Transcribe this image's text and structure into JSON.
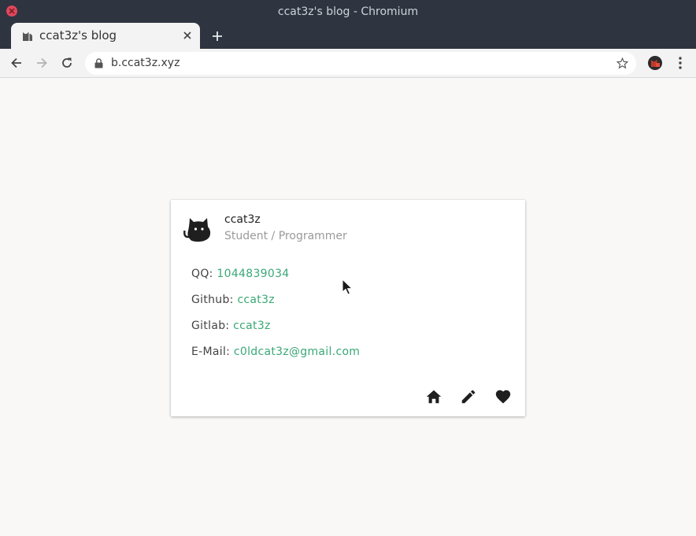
{
  "window": {
    "title": "ccat3z's blog - Chromium"
  },
  "tab": {
    "title": "ccat3z's blog",
    "favicon": "cat-icon"
  },
  "toolbar": {
    "url": "b.ccat3z.xyz",
    "icons": [
      "back-icon",
      "forward-icon",
      "reload-icon",
      "lock-icon",
      "star-icon",
      "extension-icon",
      "menu-icon"
    ]
  },
  "profile": {
    "name": "ccat3z",
    "role": "Student / Programmer",
    "avatar": "cat-icon"
  },
  "contacts": [
    {
      "label": "QQ: ",
      "value": "1044839034"
    },
    {
      "label": "Github: ",
      "value": "ccat3z"
    },
    {
      "label": "Gitlab: ",
      "value": "ccat3z"
    },
    {
      "label": "E-Mail: ",
      "value": "c0ldcat3z@gmail.com"
    }
  ],
  "actions": [
    "home-icon",
    "pencil-icon",
    "heart-icon"
  ],
  "colors": {
    "chrome_bg": "#2e3440",
    "accent": "#3aa876",
    "close": "#e0475b",
    "page_bg": "#f9f8f6"
  }
}
